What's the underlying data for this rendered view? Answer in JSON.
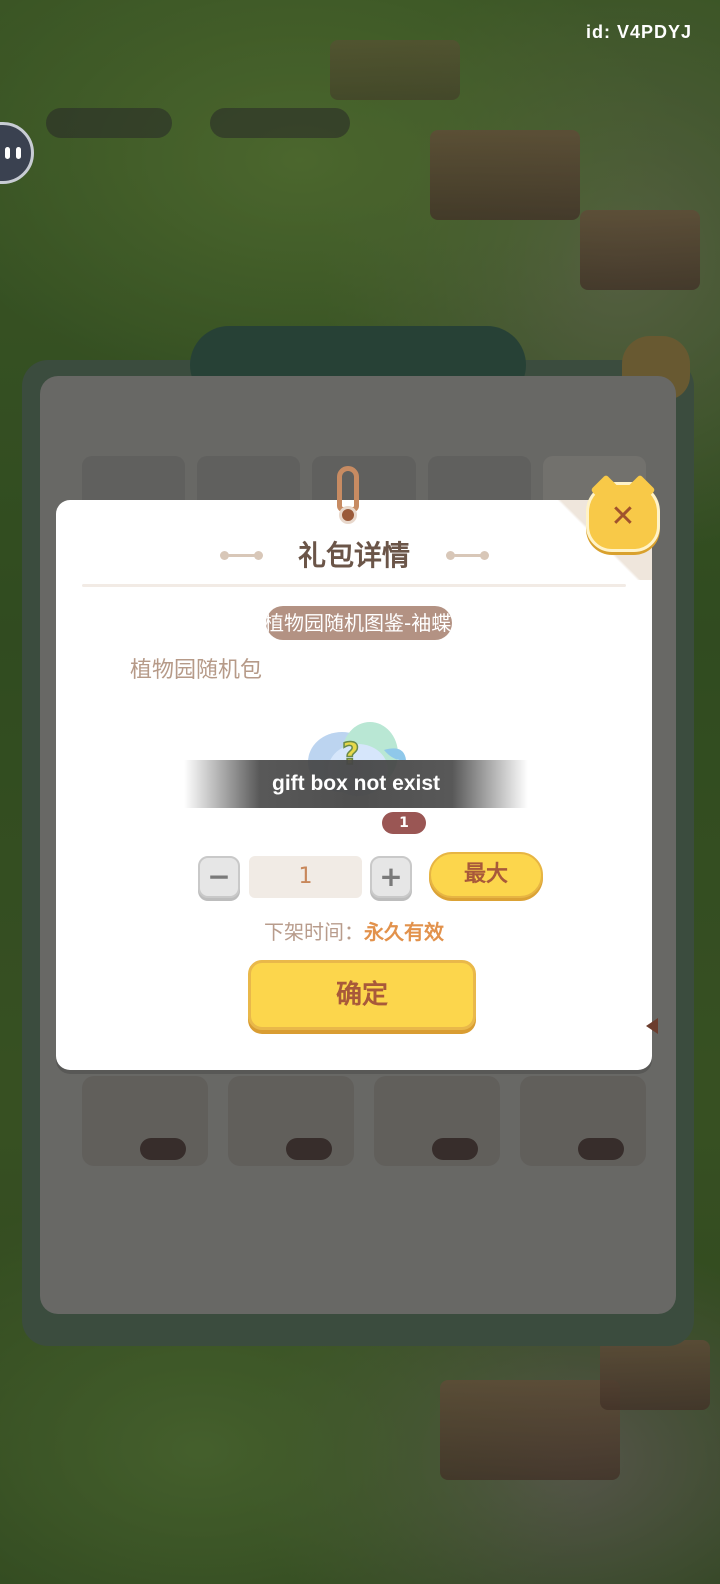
{
  "overlay": {
    "user_id": "id: V4PDYJ"
  },
  "shop": {
    "title": "",
    "tabs": [
      "",
      "",
      "",
      "",
      ""
    ],
    "footer": ""
  },
  "dialog": {
    "title": "礼包详情",
    "item_name": "植物园随机图鉴-袖蝶",
    "item_description": "植物园随机包",
    "error_message": "gift box not exist",
    "count_badge": "1",
    "quantity": "1",
    "max_label": "最大",
    "minus_icon": "minus-icon",
    "plus_icon": "plus-icon",
    "close_icon": "close-icon",
    "expiry_label": "下架时间：",
    "expiry_value": "永久有效",
    "confirm_label": "确定"
  },
  "colors": {
    "title_text": "#6b5548",
    "accent_yellow": "#fcd64c",
    "button_text": "#a8593a",
    "expiry_value": "#e2924c",
    "badge_bg": "#9a5654",
    "name_pill_bg": "#b39283"
  }
}
